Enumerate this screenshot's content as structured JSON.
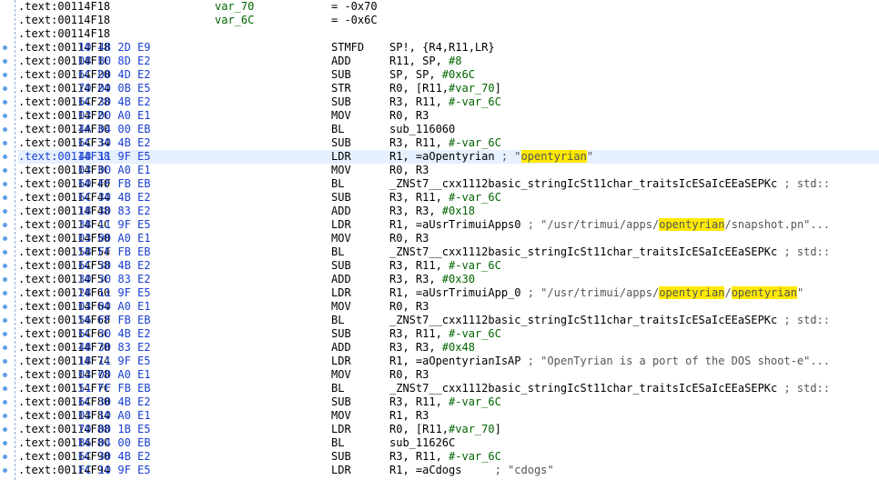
{
  "highlight": "opentyrian",
  "lines": [
    {
      "addr": ".text:00114F18",
      "name": "var_70",
      "eq": "= -0x70"
    },
    {
      "addr": ".text:00114F18",
      "name": "var_6C",
      "eq": "= -0x6C"
    },
    {
      "addr": ".text:00114F18"
    },
    {
      "addr": ".text:00114F18",
      "bytes": "10 48 2D E9",
      "mnem": "STMFD",
      "ops": [
        {
          "t": "SP!, {R4,R11,LR}"
        }
      ]
    },
    {
      "addr": ".text:00114F1C",
      "bytes": "08 B0 8D E2",
      "mnem": "ADD",
      "ops": [
        {
          "t": "R11, SP, "
        },
        {
          "t": "#8",
          "c": "grn"
        }
      ]
    },
    {
      "addr": ".text:00114F20",
      "bytes": "6C D0 4D E2",
      "mnem": "SUB",
      "ops": [
        {
          "t": "SP, SP, "
        },
        {
          "t": "#0x6C",
          "c": "grn"
        }
      ]
    },
    {
      "addr": ".text:00114F24",
      "bytes": "70 00 0B E5",
      "mnem": "STR",
      "ops": [
        {
          "t": "R0, [R11,"
        },
        {
          "t": "#var_70",
          "c": "grn"
        },
        {
          "t": "]"
        }
      ]
    },
    {
      "addr": ".text:00114F28",
      "bytes": "6C 30 4B E2",
      "mnem": "SUB",
      "ops": [
        {
          "t": "R3, R11, "
        },
        {
          "t": "#-var_6C",
          "c": "grn"
        }
      ]
    },
    {
      "addr": ".text:00114F2C",
      "bytes": "03 00 A0 E1",
      "mnem": "MOV",
      "ops": [
        {
          "t": "R0, R3"
        }
      ]
    },
    {
      "addr": ".text:00114F30",
      "bytes": "4A 04 00 EB",
      "mnem": "BL",
      "ops": [
        {
          "t": "sub_116060"
        }
      ]
    },
    {
      "addr": ".text:00114F34",
      "bytes": "6C 30 4B E2",
      "mnem": "SUB",
      "ops": [
        {
          "t": "R3, R11, "
        },
        {
          "t": "#-var_6C",
          "c": "grn"
        }
      ]
    },
    {
      "addr": ".text:00114F38",
      "bytes": "48 11 9F E5",
      "mnem": "LDR",
      "sel": true,
      "ops": [
        {
          "t": "R1, =aOpentyrian "
        },
        {
          "t": "; \"",
          "c": "cmt"
        },
        {
          "t": "opentyrian",
          "c": "hl"
        },
        {
          "t": "\"",
          "c": "cmt"
        }
      ]
    },
    {
      "addr": ".text:00114F3C",
      "bytes": "03 00 A0 E1",
      "mnem": "MOV",
      "ops": [
        {
          "t": "R0, R3"
        }
      ]
    },
    {
      "addr": ".text:00114F40",
      "bytes": "60 FF FB EB",
      "mnem": "BL",
      "ops": [
        {
          "t": "_ZNSt7__cxx1112basic_stringIcSt11char_traitsIcESaIcEEaSEPKc "
        },
        {
          "t": "; std::",
          "c": "cmt"
        }
      ]
    },
    {
      "addr": ".text:00114F44",
      "bytes": "6C 30 4B E2",
      "mnem": "SUB",
      "ops": [
        {
          "t": "R3, R11, "
        },
        {
          "t": "#-var_6C",
          "c": "grn"
        }
      ]
    },
    {
      "addr": ".text:00114F48",
      "bytes": "18 30 83 E2",
      "mnem": "ADD",
      "ops": [
        {
          "t": "R3, R3, "
        },
        {
          "t": "#0x18",
          "c": "grn"
        }
      ]
    },
    {
      "addr": ".text:00114F4C",
      "bytes": "38 11 9F E5",
      "mnem": "LDR",
      "ops": [
        {
          "t": "R1, =aUsrTrimuiApps0 "
        },
        {
          "t": "; \"/usr/trimui/apps/",
          "c": "cmt"
        },
        {
          "t": "opentyrian",
          "c": "hl"
        },
        {
          "t": "/snapshot.pn\"...",
          "c": "cmt"
        }
      ]
    },
    {
      "addr": ".text:00114F50",
      "bytes": "03 00 A0 E1",
      "mnem": "MOV",
      "ops": [
        {
          "t": "R0, R3"
        }
      ]
    },
    {
      "addr": ".text:00114F54",
      "bytes": "5B FF FB EB",
      "mnem": "BL",
      "ops": [
        {
          "t": "_ZNSt7__cxx1112basic_stringIcSt11char_traitsIcESaIcEEaSEPKc "
        },
        {
          "t": "; std::",
          "c": "cmt"
        }
      ]
    },
    {
      "addr": ".text:00114F58",
      "bytes": "6C 30 4B E2",
      "mnem": "SUB",
      "ops": [
        {
          "t": "R3, R11, "
        },
        {
          "t": "#-var_6C",
          "c": "grn"
        }
      ]
    },
    {
      "addr": ".text:00114F5C",
      "bytes": "30 30 83 E2",
      "mnem": "ADD",
      "ops": [
        {
          "t": "R3, R3, "
        },
        {
          "t": "#0x30",
          "c": "grn"
        }
      ]
    },
    {
      "addr": ".text:00114F60",
      "bytes": "28 11 9F E5",
      "mnem": "LDR",
      "ops": [
        {
          "t": "R1, =aUsrTrimuiApp_0 "
        },
        {
          "t": "; \"/usr/trimui/apps/",
          "c": "cmt"
        },
        {
          "t": "opentyrian",
          "c": "hl"
        },
        {
          "t": "/",
          "c": "cmt"
        },
        {
          "t": "opentyrian",
          "c": "hl"
        },
        {
          "t": "\"",
          "c": "cmt"
        }
      ]
    },
    {
      "addr": ".text:00114F64",
      "bytes": "03 00 A0 E1",
      "mnem": "MOV",
      "ops": [
        {
          "t": "R0, R3"
        }
      ]
    },
    {
      "addr": ".text:00114F68",
      "bytes": "56 FF FB EB",
      "mnem": "BL",
      "ops": [
        {
          "t": "_ZNSt7__cxx1112basic_stringIcSt11char_traitsIcESaIcEEaSEPKc "
        },
        {
          "t": "; std::",
          "c": "cmt"
        }
      ]
    },
    {
      "addr": ".text:00114F6C",
      "bytes": "6C 30 4B E2",
      "mnem": "SUB",
      "ops": [
        {
          "t": "R3, R11, "
        },
        {
          "t": "#-var_6C",
          "c": "grn"
        }
      ]
    },
    {
      "addr": ".text:00114F70",
      "bytes": "48 30 83 E2",
      "mnem": "ADD",
      "ops": [
        {
          "t": "R3, R3, "
        },
        {
          "t": "#0x48",
          "c": "grn"
        }
      ]
    },
    {
      "addr": ".text:00114F74",
      "bytes": "18 11 9F E5",
      "mnem": "LDR",
      "ops": [
        {
          "t": "R1, =aOpentyrianIsAP "
        },
        {
          "t": "; \"OpenTyrian is a port of the DOS shoot-e\"...",
          "c": "cmt"
        }
      ]
    },
    {
      "addr": ".text:00114F78",
      "bytes": "03 00 A0 E1",
      "mnem": "MOV",
      "ops": [
        {
          "t": "R0, R3"
        }
      ]
    },
    {
      "addr": ".text:00114F7C",
      "bytes": "51 FF FB EB",
      "mnem": "BL",
      "ops": [
        {
          "t": "_ZNSt7__cxx1112basic_stringIcSt11char_traitsIcESaIcEEaSEPKc "
        },
        {
          "t": "; std::",
          "c": "cmt"
        }
      ]
    },
    {
      "addr": ".text:00114F80",
      "bytes": "6C 30 4B E2",
      "mnem": "SUB",
      "ops": [
        {
          "t": "R3, R11, "
        },
        {
          "t": "#-var_6C",
          "c": "grn"
        }
      ]
    },
    {
      "addr": ".text:00114F84",
      "bytes": "03 10 A0 E1",
      "mnem": "MOV",
      "ops": [
        {
          "t": "R1, R3"
        }
      ]
    },
    {
      "addr": ".text:00114F88",
      "bytes": "70 00 1B E5",
      "mnem": "LDR",
      "ops": [
        {
          "t": "R0, [R11,"
        },
        {
          "t": "#var_70",
          "c": "grn"
        },
        {
          "t": "]"
        }
      ]
    },
    {
      "addr": ".text:00114F8C",
      "bytes": "B6 04 00 EB",
      "mnem": "BL",
      "ops": [
        {
          "t": "sub_11626C"
        }
      ]
    },
    {
      "addr": ".text:00114F90",
      "bytes": "6C 30 4B E2",
      "mnem": "SUB",
      "ops": [
        {
          "t": "R3, R11, "
        },
        {
          "t": "#-var_6C",
          "c": "grn"
        }
      ]
    },
    {
      "addr": ".text:00114F94",
      "bytes": "FC 10 9F E5",
      "mnem": "LDR",
      "ops": [
        {
          "t": "R1, =aCdogs     "
        },
        {
          "t": "; \"cdogs\"",
          "c": "cmt"
        }
      ]
    }
  ]
}
